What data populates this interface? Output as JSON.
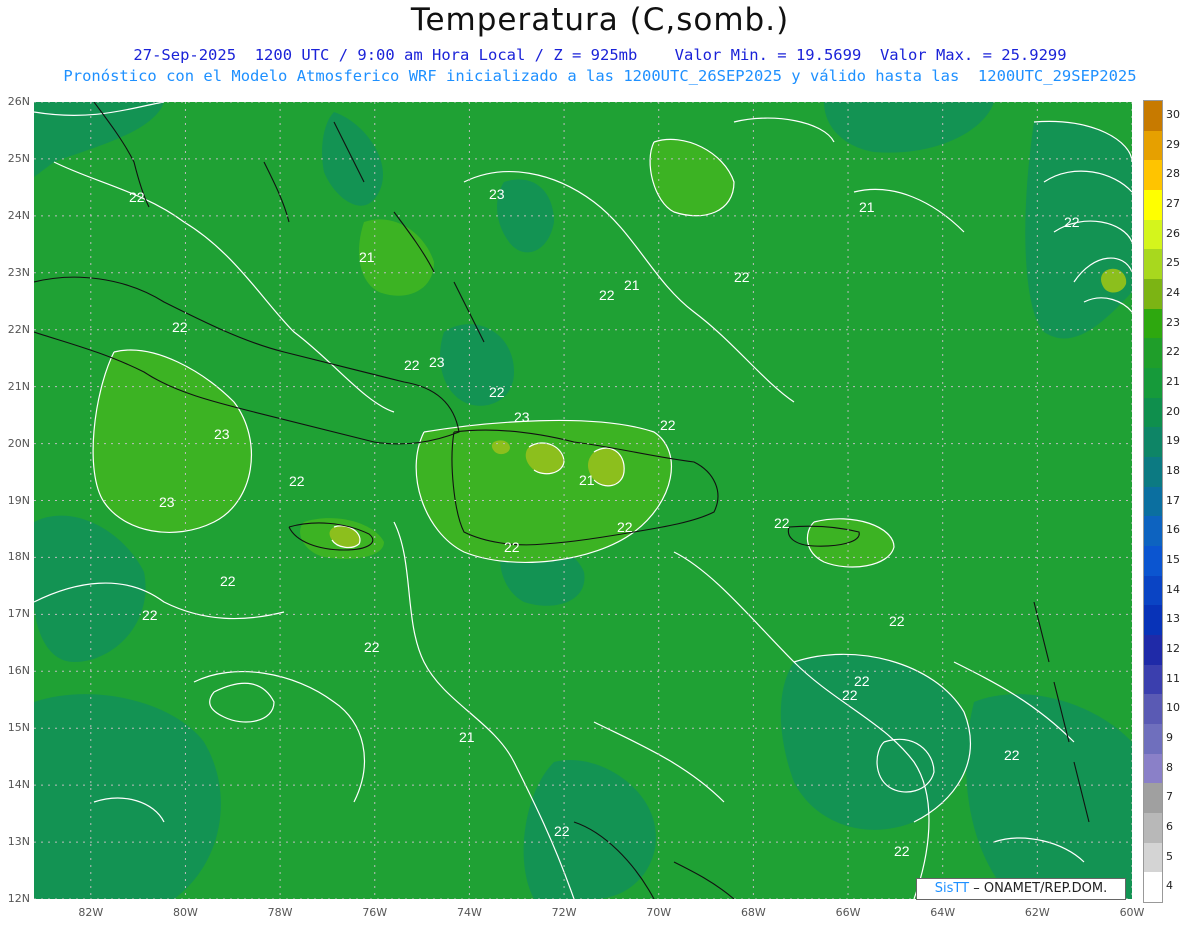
{
  "header": {
    "title": "Temperatura (C,somb.)",
    "subtitle_line1": "27-Sep-2025  1200 UTC / 9:00 am Hora Local / Z = 925mb    Valor Min. = 19.5699  Valor Max. = 25.9299",
    "subtitle_line2": "Pronóstico con el Modelo Atmosferico WRF inicializado a las 1200UTC_26SEP2025 y válido hasta las  1200UTC_29SEP2025"
  },
  "axes": {
    "lat_labels": [
      "26N",
      "25N",
      "24N",
      "23N",
      "22N",
      "21N",
      "20N",
      "19N",
      "18N",
      "17N",
      "16N",
      "15N",
      "14N",
      "13N",
      "12N"
    ],
    "lon_labels": [
      "82W",
      "80W",
      "78W",
      "76W",
      "74W",
      "72W",
      "70W",
      "68W",
      "66W",
      "64W",
      "62W",
      "60W"
    ],
    "lat_range": [
      12,
      26
    ],
    "lon_range": [
      -83.2,
      -60
    ]
  },
  "legend": {
    "levels": [
      "30",
      "29",
      "28",
      "27",
      "26",
      "25",
      "24",
      "23",
      "22",
      "21",
      "20",
      "19",
      "18",
      "17",
      "16",
      "15",
      "14",
      "13",
      "12",
      "11",
      "10",
      "9",
      "8",
      "7",
      "6",
      "5",
      "4"
    ],
    "colors": [
      "#c77a00",
      "#e6a000",
      "#ffc400",
      "#ffff00",
      "#d4f51c",
      "#a8d81e",
      "#7cb414",
      "#2ea80f",
      "#1f9e2a",
      "#169a3a",
      "#0f8f4d",
      "#0e8566",
      "#0c7a82",
      "#0b6fa0",
      "#0d63c0",
      "#0b55d0",
      "#0a44c4",
      "#0833b8",
      "#1f2aa8",
      "#3b3fae",
      "#5a5ab4",
      "#6f6fbd",
      "#8a80c8",
      "#a0a0a0",
      "#b8b8b8",
      "#d4d4d4",
      "#ffffff"
    ]
  },
  "map": {
    "contour_labels": [
      "21",
      "22",
      "23",
      "22",
      "21",
      "22",
      "22",
      "21",
      "22",
      "23",
      "23",
      "22",
      "22",
      "23",
      "22",
      "21",
      "22",
      "23",
      "22",
      "22",
      "22",
      "22",
      "22",
      "22",
      "22",
      "22",
      "22",
      "21",
      "22",
      "22",
      "22"
    ],
    "colors": {
      "base": "#1fa134",
      "warm": "#3cb323",
      "cool": "#139353",
      "hot": "#8cbf1d",
      "coastline": "#111111",
      "contour": "#ffffff",
      "grid": "#bdbdbd"
    }
  },
  "credit": {
    "brand": "SisTT",
    "text": "– ONAMET/REP.DOM."
  }
}
